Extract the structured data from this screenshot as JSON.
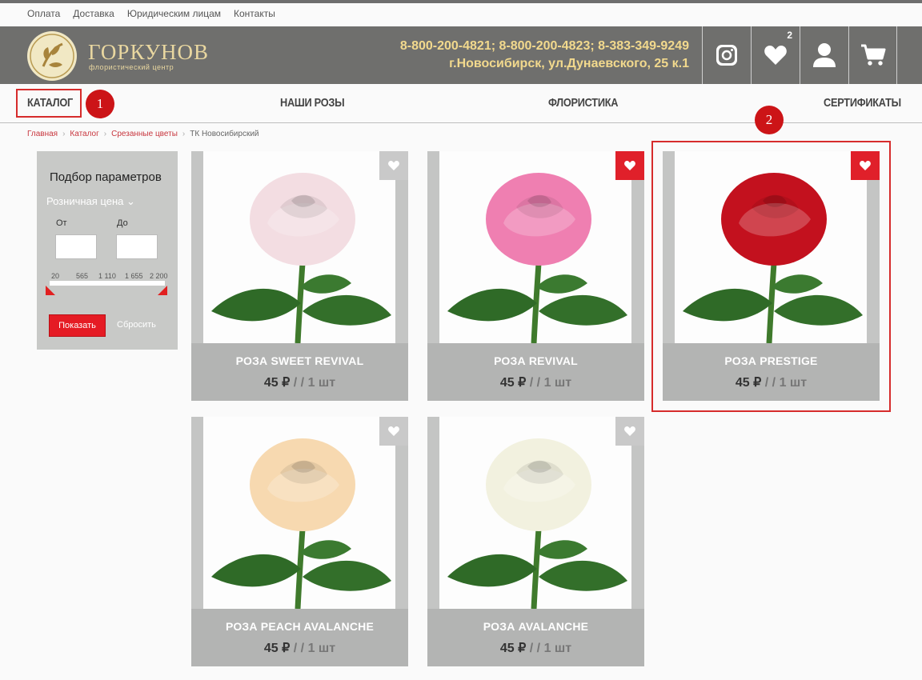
{
  "top_links": [
    "Оплата",
    "Доставка",
    "Юридическим лицам",
    "Контакты"
  ],
  "header": {
    "brand": "ГОРКУНОВ",
    "brand_sub": "флористический центр",
    "phones": "8-800-200-4821; 8-800-200-4823; 8-383-349-9249",
    "address": "г.Новосибирск, ул.Дунаевского, 25 к.1",
    "favorites_count": "2",
    "accent_color": "#f2d98d",
    "background_color": "#6f6f6d",
    "icons": [
      "instagram-icon",
      "heart-icon",
      "user-icon",
      "cart-icon"
    ]
  },
  "nav": {
    "items": [
      "КАТАЛОГ",
      "НАШИ РОЗЫ",
      "ФЛОРИСТИКА",
      "СЕРТИФИКАТЫ"
    ]
  },
  "markers": [
    "1",
    "2"
  ],
  "breadcrumbs": {
    "links": [
      "Главная",
      "Каталог",
      "Срезанные цветы"
    ],
    "current": "ТК Новосибирский"
  },
  "filter": {
    "title": "Подбор параметров",
    "price_label": "Розничная цена",
    "from_label": "От",
    "to_label": "До",
    "from_value": "",
    "to_value": "",
    "scale": [
      "20",
      "565",
      "1 110",
      "1 655",
      "2 200"
    ],
    "show_button": "Показать",
    "reset_button": "Сбросить"
  },
  "products": [
    {
      "name": "РОЗА SWEET REVIVAL",
      "price": "45 ₽",
      "unit": "/ / 1 шт",
      "favorite": false,
      "rose_color": "#f3dde2"
    },
    {
      "name": "РОЗА REVIVAL",
      "price": "45 ₽",
      "unit": "/ / 1 шт",
      "favorite": true,
      "rose_color": "#ef7fb1"
    },
    {
      "name": "РОЗА PRESTIGE",
      "price": "45 ₽",
      "unit": "/ / 1 шт",
      "favorite": true,
      "rose_color": "#c3111e"
    },
    {
      "name": "РОЗА PEACH AVALANCHE",
      "price": "45 ₽",
      "unit": "/ / 1 шт",
      "favorite": false,
      "rose_color": "#f7d9b0"
    },
    {
      "name": "РОЗА AVALANCHE",
      "price": "45 ₽",
      "unit": "/ / 1 шт",
      "favorite": false,
      "rose_color": "#f2f1df"
    }
  ]
}
